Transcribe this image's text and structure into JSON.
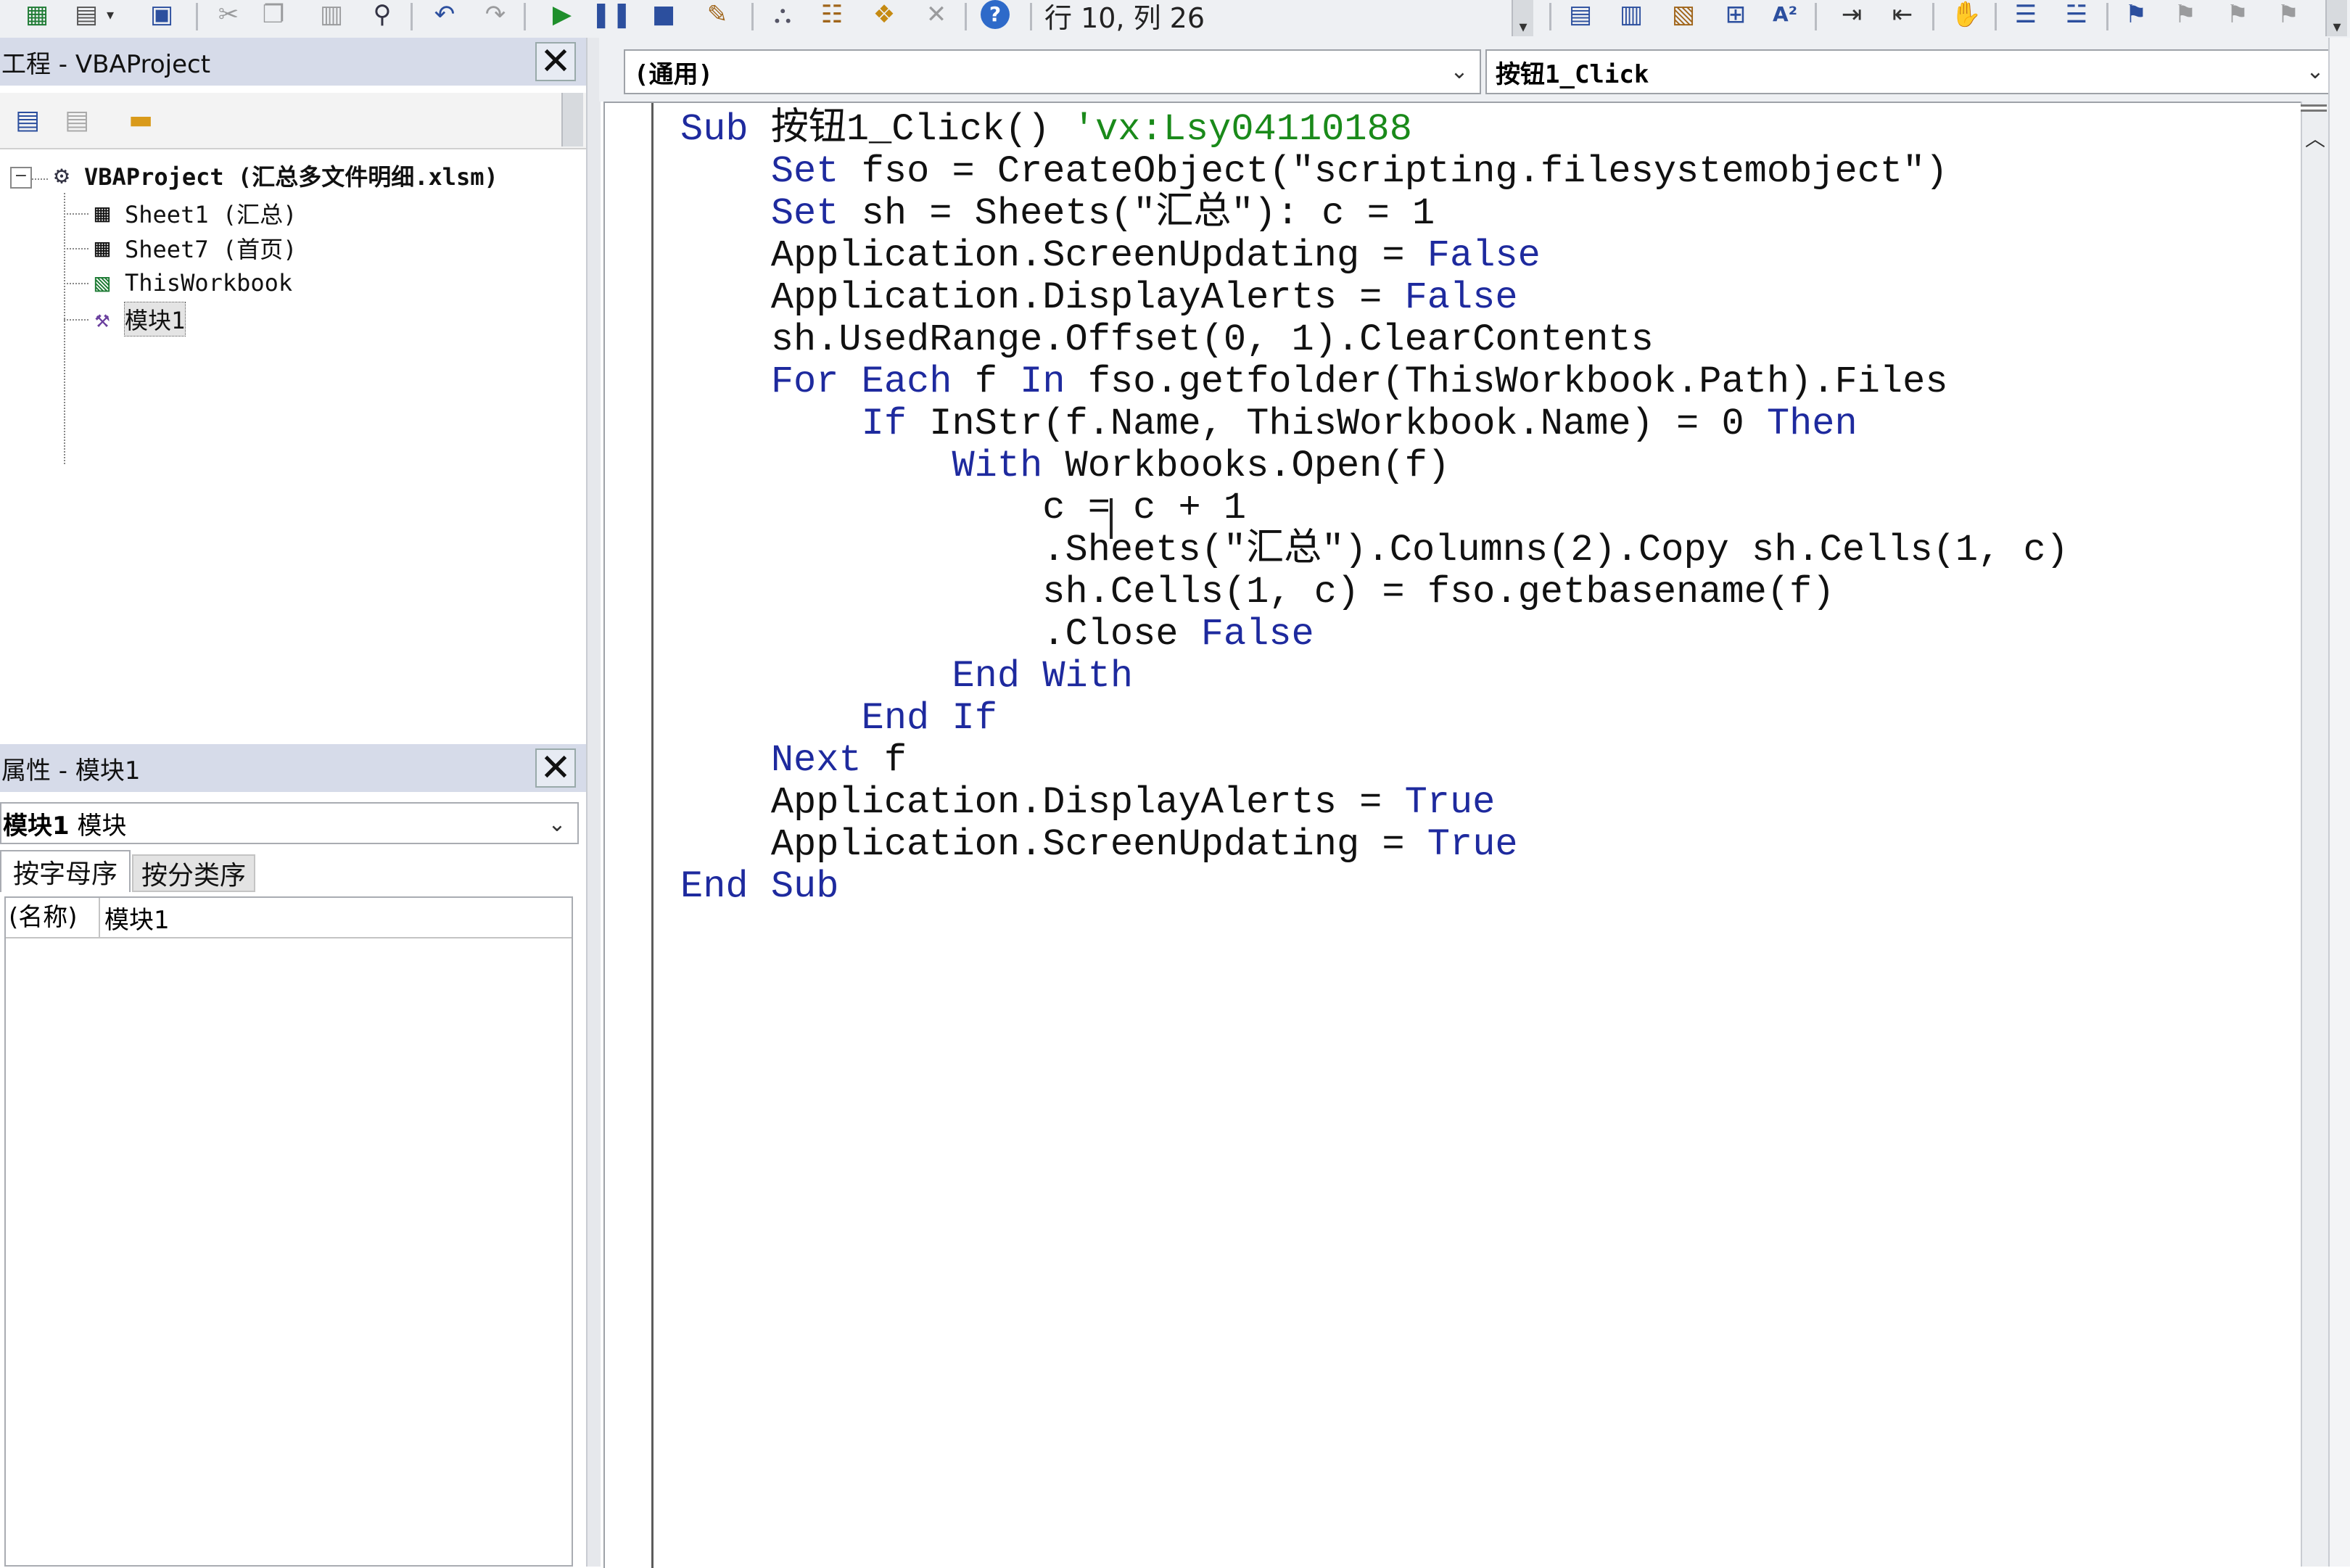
{
  "toolbar": {
    "position_label": "行 10, 列 26",
    "icons": [
      "excel-icon",
      "insert-userform-icon",
      "save-icon",
      "cut-icon",
      "copy-icon",
      "paste-icon",
      "find-icon",
      "undo-icon",
      "redo-icon",
      "run-icon",
      "break-icon",
      "reset-icon",
      "design-mode-icon",
      "project-explorer-icon",
      "properties-icon",
      "object-browser-icon",
      "toolbox-icon",
      "help-icon"
    ],
    "edit_icons": [
      "list-properties-icon",
      "list-constants-icon",
      "quick-info-icon",
      "parameter-info-icon",
      "complete-word-icon",
      "indent-icon",
      "outdent-icon",
      "toggle-breakpoint-icon",
      "comment-block-icon",
      "uncomment-block-icon",
      "toggle-bookmark-icon",
      "next-bookmark-icon",
      "prev-bookmark-icon",
      "clear-bookmarks-icon"
    ]
  },
  "project_panel": {
    "title": "工程 - VBAProject",
    "tree": {
      "root": "VBAProject (汇总多文件明细.xlsm)",
      "items": [
        {
          "label": "Sheet1 (汇总)",
          "icon": "worksheet-icon"
        },
        {
          "label": "Sheet7 (首页)",
          "icon": "worksheet-icon"
        },
        {
          "label": "ThisWorkbook",
          "icon": "workbook-icon"
        },
        {
          "label": "模块1",
          "icon": "module-icon",
          "selected": true
        }
      ]
    }
  },
  "properties_panel": {
    "title": "属性 - 模块1",
    "object_bold": "模块1",
    "object_type": "模块",
    "tabs": [
      {
        "label": "按字母序",
        "active": true
      },
      {
        "label": "按分类序",
        "active": false
      }
    ],
    "rows": [
      {
        "name": "(名称)",
        "value": "模块1"
      }
    ]
  },
  "code_window": {
    "object_combo": "(通用)",
    "procedure_combo": "按钮1_Click",
    "lines": [
      "Sub 按钮1_Click() 'vx:Lsy04110188",
      "    Set fso = CreateObject(\"scripting.filesystemobject\")",
      "    Set sh = Sheets(\"汇总\"): c = 1",
      "    Application.ScreenUpdating = False",
      "    Application.DisplayAlerts = False",
      "    sh.UsedRange.Offset(0, 1).ClearContents",
      "    For Each f In fso.getfolder(ThisWorkbook.Path).Files",
      "        If InStr(f.Name, ThisWorkbook.Name) = 0 Then",
      "            With Workbooks.Open(f)",
      "                c = c + 1",
      "                .Sheets(\"汇总\").Columns(2).Copy sh.Cells(1, c)",
      "                sh.Cells(1, c) = fso.getbasename(f)",
      "                .Close False",
      "            End With",
      "        End If",
      "    Next f",
      "    Application.DisplayAlerts = True",
      "    Application.ScreenUpdating = True",
      "End Sub"
    ]
  },
  "colors": {
    "keyword": "#1e2a9e",
    "comment": "#1a8a1a",
    "panel_title_bg": "#d6dbe9"
  }
}
